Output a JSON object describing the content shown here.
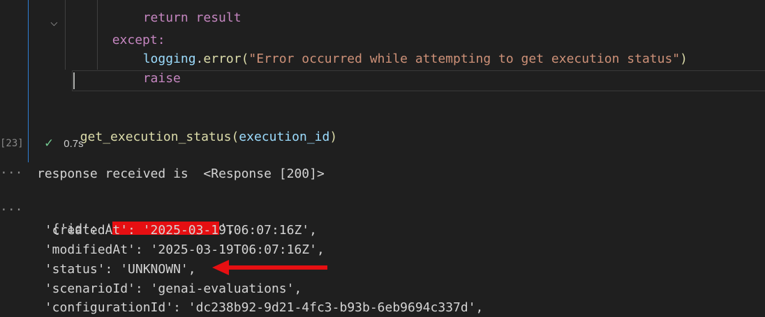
{
  "code": {
    "line_return": "return result",
    "line_except": "except:",
    "logging_obj": "logging",
    "logging_dot": ".",
    "logging_fn": "error",
    "logging_open": "(",
    "logging_msg": "\"Error occurred while attempting to get execution status\"",
    "logging_close": ")",
    "line_raise": "raise",
    "call_fn": "get_execution_status",
    "call_open": "(",
    "call_arg": "execution_id",
    "call_close": ")"
  },
  "execution": {
    "count": "[23]",
    "duration": "0.7s",
    "success_icon": "check-icon"
  },
  "output": {
    "more_icon": "···",
    "response_line": "response received is  <Response [200]>",
    "id_prefix": "{'id': '",
    "id_suffix": "',",
    "created_line": " 'createdAt': '2025-03-19T06:07:16Z',",
    "modified_line": " 'modifiedAt': '2025-03-19T06:07:16Z',",
    "status_line": " 'status': 'UNKNOWN',",
    "scenario_line": " 'scenarioId': 'genai-evaluations',",
    "configuration_line": " 'configurationId': 'dc238b92-9d21-4fc3-b93b-6eb9694c337d',"
  },
  "colors": {
    "annotation": "#e60f12",
    "cell_border": "#2f7fd4",
    "success": "#73c991"
  }
}
